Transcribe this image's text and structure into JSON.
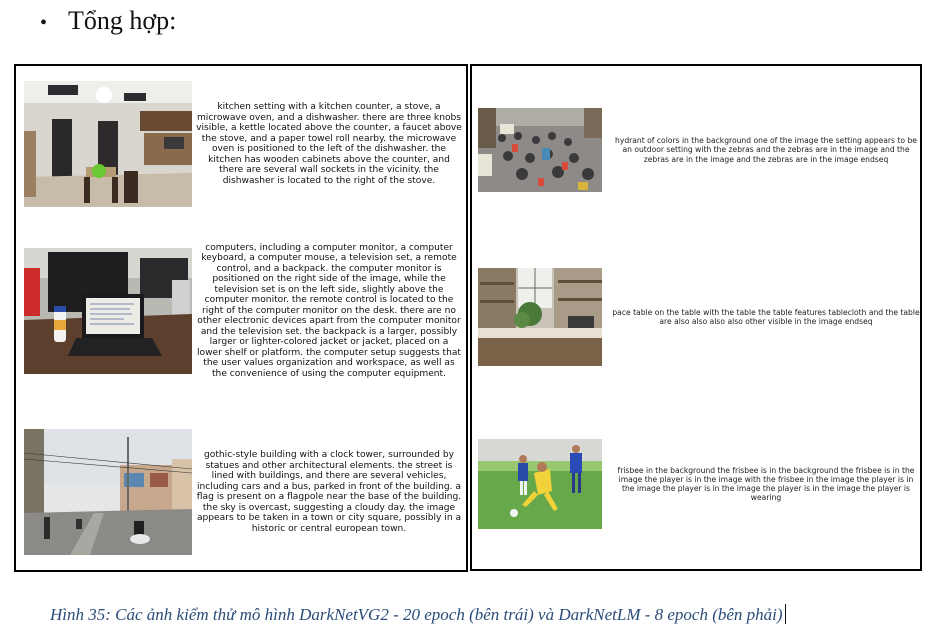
{
  "heading": {
    "bullet": "•",
    "text": "Tổng hợp:"
  },
  "left_panel": {
    "entries": [
      {
        "image": "kitchen-photo",
        "caption": "kitchen setting with a kitchen counter, a stove, a microwave oven, and a dishwasher. there are three knobs visible, a kettle located above the counter, a faucet above the stove, and a paper towel roll nearby. the microwave oven is positioned to the left of the dishwasher. the kitchen has wooden cabinets above the counter, and there are several wall sockets in the vicinity. the dishwasher is located to the right of the stove."
      },
      {
        "image": "laptop-desk-photo",
        "caption": "computers, including a computer monitor, a computer keyboard, a computer mouse, a television set, a remote control, and a backpack. the computer monitor is positioned on the right side of the image, while the television set is on the left side, slightly above the computer monitor. the remote control is located to the right of the computer monitor on the desk. there are no other electronic devices apart from the computer monitor and the television set. the backpack is a larger, possibly larger or lighter-colored jacket or jacket, placed on a lower shelf or platform. the computer setup suggests that the user values organization and workspace, as well as the convenience of using the computer equipment."
      },
      {
        "image": "street-photo",
        "caption": "gothic-style building with a clock tower, surrounded by statues and other architectural elements. the street is lined with buildings, and there are several vehicles, including cars and a bus, parked in front of the building. a flag is present on a flagpole near the base of the building. the sky is overcast, suggesting a cloudy day. the image appears to be taken in a town or city square, possibly in a historic or central european town."
      }
    ]
  },
  "right_panel": {
    "entries": [
      {
        "image": "traffic-photo",
        "caption": "hydrant of colors in the background one of the image the setting appears to be an outdoor setting with the zebras and the zebras are in the image and the zebras are in the image and the zebras are in the image endseq"
      },
      {
        "image": "kitchen-interior-photo",
        "caption": "pace table on the table with the table the table features tablecloth and the table are also also also also other visible in the image endseq"
      },
      {
        "image": "football-photo",
        "caption": "frisbee in the background the frisbee is in the background the frisbee is in the image the player is in the image with the frisbee in the image the player is in the image the player is in the image the player is in the image the player is wearing"
      }
    ]
  },
  "figure_caption": "Hình 35: Các ảnh kiểm thử mô hình DarkNetVG2 - 20 epoch (bên trái) và DarkNetLM - 8 epoch (bên phải)"
}
